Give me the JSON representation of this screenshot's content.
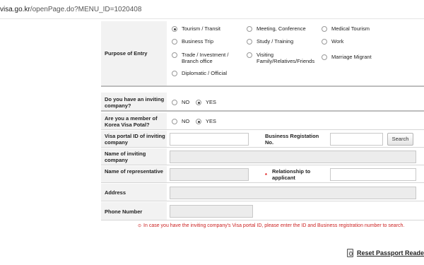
{
  "browser": {
    "url_domain": "visa.go.kr",
    "url_path": "/openPage.do?MENU_ID=1020408"
  },
  "form": {
    "purpose": {
      "label": "Purpose of Entry",
      "options": [
        {
          "label": "Tourism / Transit",
          "checked": true
        },
        {
          "label": "Meeting, Conference",
          "checked": false
        },
        {
          "label": "Medical Tourism",
          "checked": false
        },
        {
          "label": "Business Trip",
          "checked": false
        },
        {
          "label": "Study / Training",
          "checked": false
        },
        {
          "label": "Work",
          "checked": false
        },
        {
          "label": "Trade / Investment / Branch office",
          "checked": false
        },
        {
          "label": "Visiting Family/Relatives/Friends",
          "checked": false
        },
        {
          "label": "Marriage Migrant",
          "checked": false
        },
        {
          "label": "Diplomatic / Official",
          "checked": false
        }
      ]
    },
    "inviting": {
      "label": "Do you have an inviting company?",
      "no": "NO",
      "yes": "YES",
      "selected": "YES"
    },
    "member": {
      "label": "Are you a member of Korea Visa Potal?",
      "no": "NO",
      "yes": "YES",
      "selected": "YES"
    },
    "portal_id": {
      "label": "Visa portal ID of inviting company",
      "value": ""
    },
    "business_reg": {
      "label": "Business Registation No.",
      "value": "",
      "search_label": "Search"
    },
    "company_name": {
      "label": "Name of inviting company",
      "value": ""
    },
    "representative": {
      "label": "Name of representative",
      "value": ""
    },
    "relationship": {
      "label": "Relationship to applicant",
      "required_mark": "*",
      "value": ""
    },
    "address": {
      "label": "Address",
      "value": ""
    },
    "phone": {
      "label": "Phone Number",
      "value": ""
    }
  },
  "notice": {
    "marker": "⊙",
    "text": "In case you have the inviting company's Visa portal ID, please enter the ID and Business registration number to search."
  },
  "reset": {
    "label": "Reset Passport Reader"
  },
  "colors": {
    "notice_red": "#cc2222",
    "label_bg": "#f2f2f2",
    "required_red": "#dd0000"
  }
}
